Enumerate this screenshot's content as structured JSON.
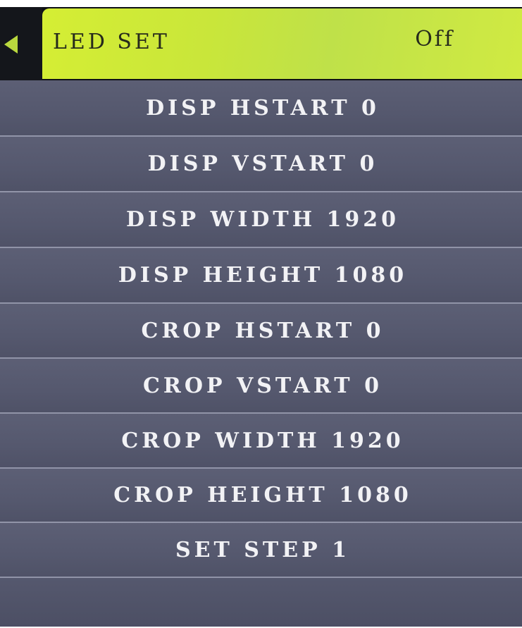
{
  "header": {
    "title": "LED SET",
    "value": "Off"
  },
  "menu": {
    "items": [
      {
        "label": "DISP HSTART 0"
      },
      {
        "label": "DISP VSTART 0"
      },
      {
        "label": "DISP WIDTH 1920"
      },
      {
        "label": "DISP HEIGHT 1080"
      },
      {
        "label": "CROP HSTART 0"
      },
      {
        "label": "CROP VSTART 0"
      },
      {
        "label": "CROP WIDTH 1920"
      },
      {
        "label": "CROP HEIGHT 1080"
      },
      {
        "label": "SET STEP 1"
      }
    ]
  },
  "colors": {
    "header_highlight": "#c9e63a",
    "row_background": "#55586e",
    "row_text": "#f2f2f5",
    "arrow": "#b9d83e"
  },
  "icons": {
    "back": "left-triangle-icon"
  }
}
